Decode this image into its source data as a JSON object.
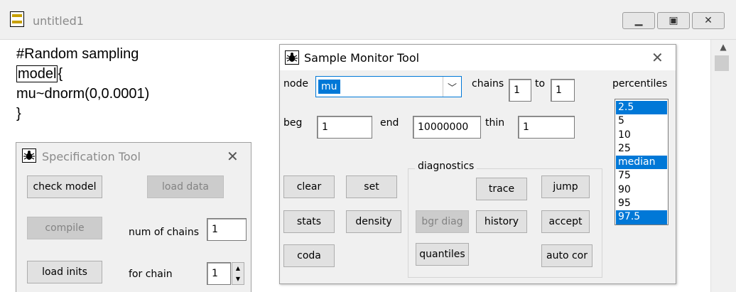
{
  "main_window": {
    "title": "untitled1",
    "icons": {
      "app": "document-app-icon",
      "minimize": "minimize-icon",
      "maximize": "maximize-icon",
      "close": "close-icon"
    }
  },
  "editor": {
    "lines": [
      "#Random sampling",
      "model",
      "{",
      "mu~dnorm(0,0.0001)",
      "}"
    ]
  },
  "spec_tool": {
    "title": "Specification Tool",
    "buttons": {
      "check_model": "check model",
      "load_data": "load data",
      "compile": "compile",
      "load_inits": "load inits"
    },
    "num_chains_label": "num of chains",
    "num_chains_value": "1",
    "for_chain_label": "for chain",
    "for_chain_value": "1"
  },
  "sample_monitor": {
    "title": "Sample Monitor Tool",
    "node_label": "node",
    "node_value": "mu",
    "chains_label": "chains",
    "chains_from": "1",
    "to_label": "to",
    "chains_to": "1",
    "beg_label": "beg",
    "beg_value": "1",
    "end_label": "end",
    "end_value": "10000000",
    "thin_label": "thin",
    "thin_value": "1",
    "percentiles_label": "percentiles",
    "percentiles": [
      "2.5",
      "5",
      "10",
      "25",
      "median",
      "75",
      "90",
      "95",
      "97.5"
    ],
    "percentiles_selected": [
      "2.5",
      "median",
      "97.5"
    ],
    "buttons": {
      "clear": "clear",
      "set": "set",
      "stats": "stats",
      "density": "density",
      "coda": "coda"
    },
    "diagnostics_label": "diagnostics",
    "diag_buttons": {
      "trace": "trace",
      "jump": "jump",
      "bgr_diag": "bgr diag",
      "history": "history",
      "accept": "accept",
      "quantiles": "quantiles",
      "auto_cor": "auto cor"
    }
  },
  "colors": {
    "selection": "#0078d7",
    "window_bg": "#f0f0f0",
    "disabled_text": "#838383"
  }
}
